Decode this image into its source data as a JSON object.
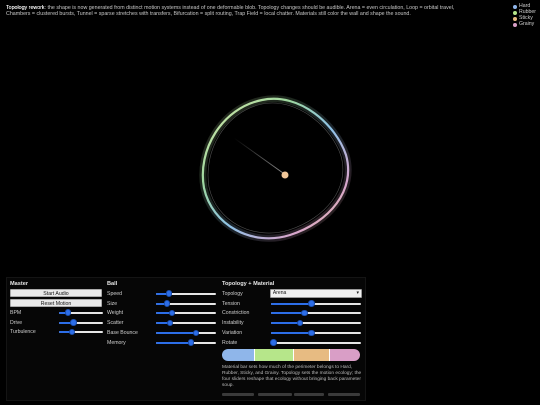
{
  "header": {
    "title_overlay": "Topology rework",
    "description": "Topology rework: the shape is now generated from distinct motion systems instead of one deformable blob. Topology changes should be audible. Arena = even circulation, Loop = orbital travel, Chambers = clustered bursts, Tunnel = sparse stretches with transfers, Bifurcation = split routing, Trap Field = local chatter. Materials still color the wall and shape the sound."
  },
  "legend": [
    {
      "label": "Hard",
      "color": "#8fb6ea"
    },
    {
      "label": "Rubber",
      "color": "#b6e68a"
    },
    {
      "label": "Sticky",
      "color": "#e7bb82"
    },
    {
      "label": "Grainy",
      "color": "#d99ec6"
    }
  ],
  "colors": {
    "accent": "#2d6ee8",
    "ball": "#f2c89a"
  },
  "master": {
    "title": "Master",
    "start_audio": "Start Audio",
    "reset_motion": "Reset Motion",
    "sliders": [
      {
        "label": "BPM",
        "value": 0.2
      },
      {
        "label": "Drive",
        "value": 0.33
      },
      {
        "label": "Turbulence",
        "value": 0.3
      }
    ]
  },
  "ball": {
    "title": "Ball",
    "sliders": [
      {
        "label": "Speed",
        "value": 0.22
      },
      {
        "label": "Size",
        "value": 0.18
      },
      {
        "label": "Weight",
        "value": 0.27
      },
      {
        "label": "Scatter",
        "value": 0.23
      },
      {
        "label": "Base Bounce",
        "value": 0.67
      },
      {
        "label": "Memory",
        "value": 0.58
      }
    ]
  },
  "topology": {
    "title": "Topology + Material",
    "topology_label": "Topology",
    "topology_value": "Arena",
    "sliders": [
      {
        "label": "Tension",
        "value": 0.45
      },
      {
        "label": "Constriction",
        "value": 0.37
      },
      {
        "label": "Instability",
        "value": 0.32
      },
      {
        "label": "Variation",
        "value": 0.45
      },
      {
        "label": "Rotate",
        "value": 0.03
      }
    ],
    "material_bar": [
      {
        "name": "Hard",
        "share": 0.24,
        "color": "#8fb6ea"
      },
      {
        "name": "Rubber",
        "share": 0.28,
        "color": "#b6e68a"
      },
      {
        "name": "Sticky",
        "share": 0.26,
        "color": "#e7bb82"
      },
      {
        "name": "Grainy",
        "share": 0.22,
        "color": "#d99ec6"
      }
    ],
    "material_note": "Material bar sets how much of the perimeter belongs to Hard, Rubber, Sticky, and Grainy. Topology sets the motion ecology; the four sliders reshape that ecology without bringing back parameter soup."
  }
}
